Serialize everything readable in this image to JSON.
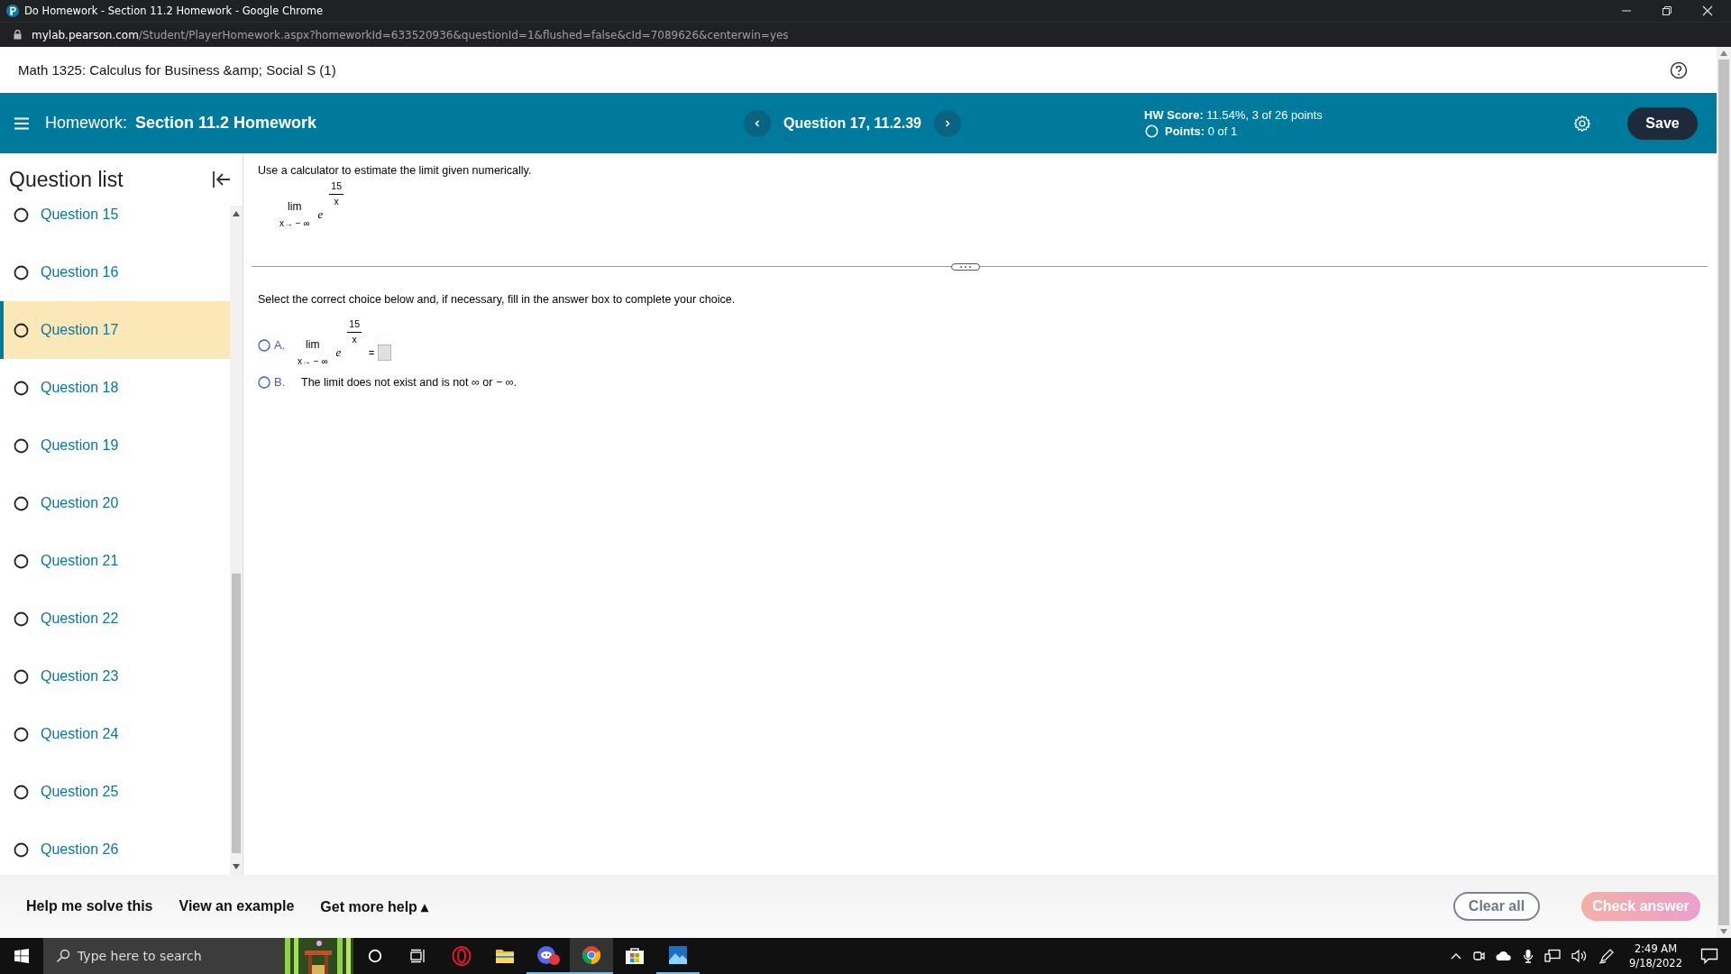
{
  "browser": {
    "tab_title": "Do Homework - Section 11.2 Homework - Google Chrome",
    "url_domain": "mylab.pearson.com",
    "url_path": "/Student/PlayerHomework.aspx?homeworkId=633520936&questionId=1&flushed=false&cId=7089626&centerwin=yes"
  },
  "course_title": "Math 1325: Calculus for Business &amp; Social S (1)",
  "header": {
    "homework_label": "Homework:",
    "homework_title": "Section 11.2 Homework",
    "question_label": "Question 17, 11.2.39",
    "hw_score_label": "HW Score:",
    "hw_score_value": "11.54%, 3 of 26 points",
    "points_label": "Points:",
    "points_value": "0 of 1",
    "save": "Save"
  },
  "sidebar": {
    "title": "Question list",
    "items": [
      {
        "label": "Question 15",
        "selected": false
      },
      {
        "label": "Question 16",
        "selected": false
      },
      {
        "label": "Question 17",
        "selected": true
      },
      {
        "label": "Question 18",
        "selected": false
      },
      {
        "label": "Question 19",
        "selected": false
      },
      {
        "label": "Question 20",
        "selected": false
      },
      {
        "label": "Question 21",
        "selected": false
      },
      {
        "label": "Question 22",
        "selected": false
      },
      {
        "label": "Question 23",
        "selected": false
      },
      {
        "label": "Question 24",
        "selected": false
      },
      {
        "label": "Question 25",
        "selected": false
      },
      {
        "label": "Question 26",
        "selected": false
      }
    ]
  },
  "question": {
    "prompt": "Use a calculator to estimate the limit given numerically.",
    "limit": {
      "lim": "lim",
      "sub": "x→ − ∞",
      "base": "e",
      "num": "15",
      "den": "x"
    },
    "instruction": "Select the correct choice below and, if necessary, fill in the answer box to complete your choice.",
    "choices": [
      {
        "kind": "formula",
        "letter": "A.",
        "selected": false,
        "lim": "lim",
        "sub": "x→ − ∞",
        "base": "e",
        "num": "15",
        "den": "x",
        "equals": "="
      },
      {
        "kind": "text",
        "letter": "B.",
        "selected": false,
        "text": "The limit does not exist and is not ∞ or − ∞."
      }
    ]
  },
  "footer": {
    "links": [
      "Help me solve this",
      "View an example",
      "Get more help ▴"
    ],
    "clear": "Clear all",
    "check": {
      "label": "Check answer",
      "disabled": true
    }
  },
  "taskbar": {
    "search_placeholder": "Type here to search",
    "time": "2:49 AM",
    "date": "9/18/2022"
  }
}
